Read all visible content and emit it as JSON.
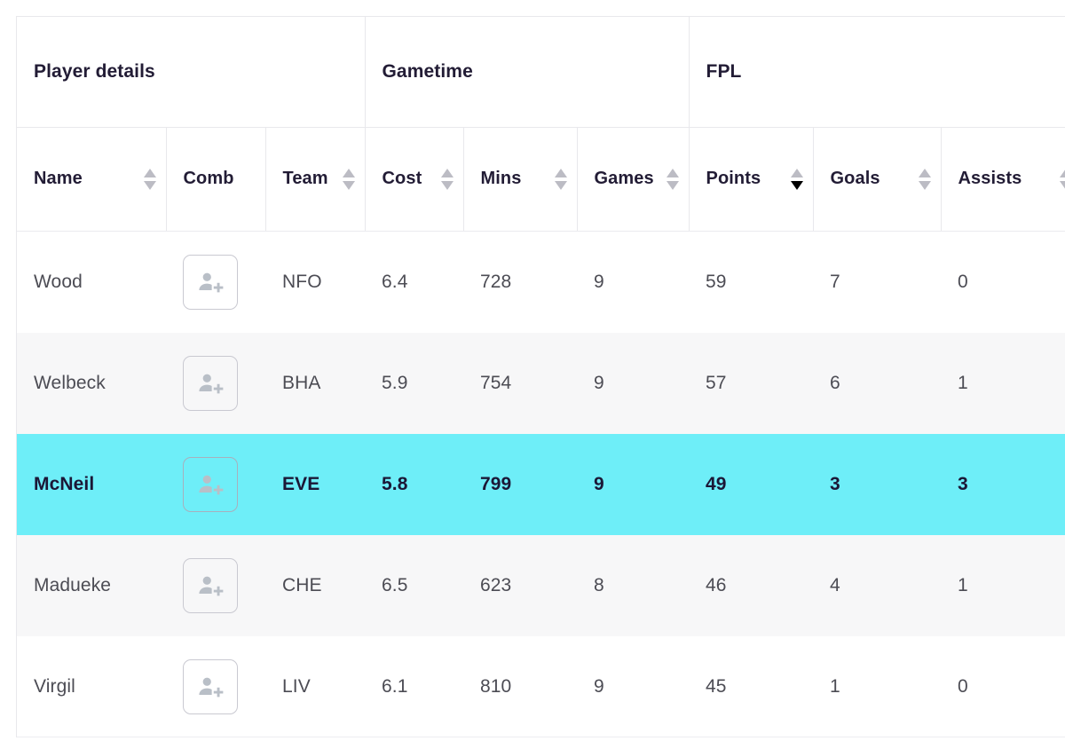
{
  "table": {
    "group_headers": [
      {
        "label": "Player details",
        "name": "group-header-player-details"
      },
      {
        "label": "Gametime",
        "name": "group-header-gametime"
      },
      {
        "label": "FPL",
        "name": "group-header-fpl"
      }
    ],
    "columns": [
      {
        "label": "Name",
        "sortable": true,
        "sort": "none"
      },
      {
        "label": "Comb",
        "sortable": false,
        "sort": "none"
      },
      {
        "label": "Team",
        "sortable": true,
        "sort": "none"
      },
      {
        "label": "Cost",
        "sortable": true,
        "sort": "none"
      },
      {
        "label": "Mins",
        "sortable": true,
        "sort": "none"
      },
      {
        "label": "Games",
        "sortable": true,
        "sort": "none"
      },
      {
        "label": "Points",
        "sortable": true,
        "sort": "desc"
      },
      {
        "label": "Goals",
        "sortable": true,
        "sort": "none"
      },
      {
        "label": "Assists",
        "sortable": true,
        "sort": "none"
      }
    ],
    "combine_icon": "add-person-icon",
    "sort_icon": "sort-arrows-icon",
    "rows": [
      {
        "name": "Wood",
        "team": "NFO",
        "cost": "6.4",
        "mins": "728",
        "games": "9",
        "points": "59",
        "goals": "7",
        "assists": "0",
        "style": "plain",
        "selected": false
      },
      {
        "name": "Welbeck",
        "team": "BHA",
        "cost": "5.9",
        "mins": "754",
        "games": "9",
        "points": "57",
        "goals": "6",
        "assists": "1",
        "style": "alt",
        "selected": false
      },
      {
        "name": "McNeil",
        "team": "EVE",
        "cost": "5.8",
        "mins": "799",
        "games": "9",
        "points": "49",
        "goals": "3",
        "assists": "3",
        "style": "selected",
        "selected": true
      },
      {
        "name": "Madueke",
        "team": "CHE",
        "cost": "6.5",
        "mins": "623",
        "games": "8",
        "points": "46",
        "goals": "4",
        "assists": "1",
        "style": "alt",
        "selected": false
      },
      {
        "name": "Virgil",
        "team": "LIV",
        "cost": "6.1",
        "mins": "810",
        "games": "9",
        "points": "45",
        "goals": "1",
        "assists": "0",
        "style": "plain",
        "selected": false
      }
    ]
  },
  "colors": {
    "selected_row": "#6EEEF8",
    "alt_row": "#F7F7F8",
    "header_text": "#221C35",
    "body_text": "#4C4C54",
    "border": "#E8E8EC",
    "sort_arrow": "#BCBCC4",
    "sort_arrow_active": "#000000"
  }
}
